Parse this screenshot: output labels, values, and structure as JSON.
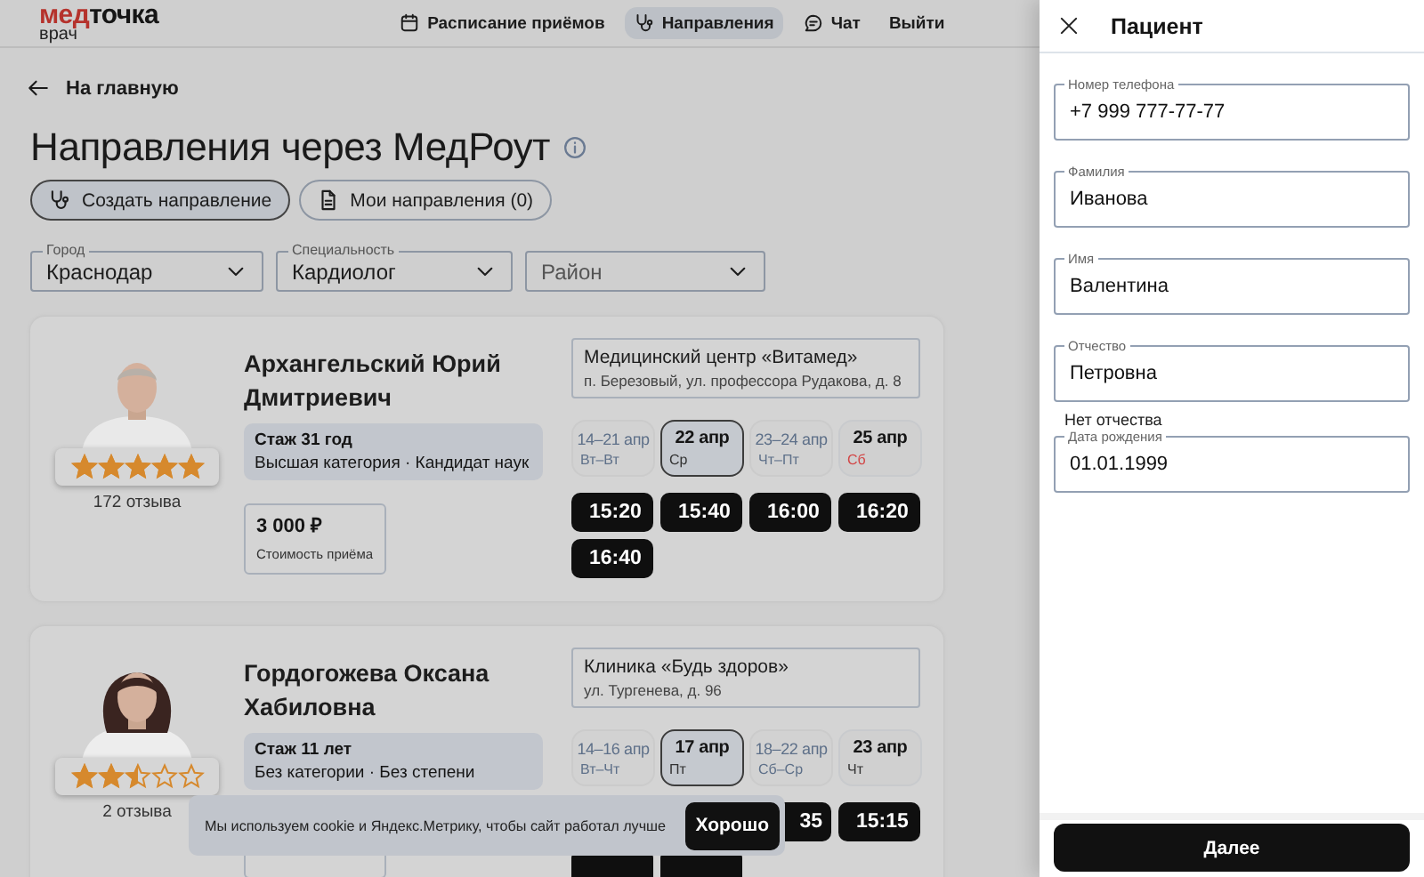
{
  "header": {
    "logo": {
      "brand_red": "мед",
      "brand_dark": "точка",
      "subtitle": "врач"
    },
    "nav": [
      {
        "label": "Расписание приёмов",
        "selected": false
      },
      {
        "label": "Направления",
        "selected": true
      },
      {
        "label": "Чат",
        "selected": false
      },
      {
        "label": "Выйти",
        "selected": false
      }
    ]
  },
  "back_link": "На главную",
  "title": "Направления через МедРоут",
  "actions": [
    {
      "label": "Создать направление",
      "selected": true
    },
    {
      "label": "Мои направления (0)",
      "selected": false
    }
  ],
  "filters": [
    {
      "label": "Город",
      "value": "Краснодар"
    },
    {
      "label": "Специальность",
      "value": "Кардиолог"
    },
    {
      "placeholder": "Район"
    }
  ],
  "doctors": [
    {
      "name": "Архангельский Юрий Дмитриевич",
      "stars": 5,
      "reviews": "172 отзыва",
      "experience": "Стаж 31 год",
      "qualification": "Высшая категория · Кандидат наук",
      "price": "3 000 ₽",
      "price_label": "Стоимость приёма",
      "clinic": "Медицинский центр «Витамед»",
      "address": "п. Березовый, ул. профессора Рудакова, д. 8",
      "dates": [
        {
          "date": "14–21 апр",
          "weekday": "Вт–Вт",
          "kind": "range",
          "selected": false,
          "weekend": false
        },
        {
          "date": "22 апр",
          "weekday": "Ср",
          "kind": "day",
          "selected": true,
          "weekend": false
        },
        {
          "date": "23–24 апр",
          "weekday": "Чт–Пт",
          "kind": "range",
          "selected": false,
          "weekend": false
        },
        {
          "date": "25 апр",
          "weekday": "Сб",
          "kind": "day",
          "selected": false,
          "weekend": true
        }
      ],
      "times": [
        {
          "time": "15:20"
        },
        {
          "time": "15:40"
        },
        {
          "time": "16:00"
        },
        {
          "time": "16:20"
        },
        {
          "time": "16:40"
        }
      ]
    },
    {
      "name": "Гордогожева Оксана Хабиловна",
      "stars": 2.5,
      "reviews": "2 отзыва",
      "experience": "Стаж 11 лет",
      "qualification": "Без категории · Без степени",
      "clinic": "Клиника «Будь здоров»",
      "address": "ул. Тургенева, д. 96",
      "dates": [
        {
          "date": "14–16 апр",
          "weekday": "Вт–Чт",
          "kind": "range",
          "selected": false,
          "weekend": false
        },
        {
          "date": "17 апр",
          "weekday": "Пт",
          "kind": "day",
          "selected": true,
          "weekend": false
        },
        {
          "date": "18–22 апр",
          "weekday": "Сб–Ср",
          "kind": "range",
          "selected": false,
          "weekend": false
        },
        {
          "date": "23 апр",
          "weekday": "Чт",
          "kind": "day",
          "selected": false,
          "weekend": false
        }
      ],
      "times": [
        {
          "time": "35",
          "kind": "partial"
        },
        {
          "time": "15:15",
          "kind": "full"
        },
        {
          "covered": true
        },
        {
          "covered": true
        }
      ]
    }
  ],
  "cookie_banner": {
    "text": "Мы используем cookie и Яндекс.Метрику, чтобы сайт работал лучше",
    "button": "Хорошо"
  },
  "patient_panel": {
    "title": "Пациент",
    "fields": [
      {
        "label": "Номер телефона",
        "value": "+7 999 777-77-77"
      },
      {
        "label": "Фамилия",
        "value": "Иванова"
      },
      {
        "label": "Имя",
        "value": "Валентина"
      },
      {
        "label": "Отчество",
        "value": "Петровна"
      },
      {
        "label": "Дата рождения",
        "value": "01.01.1999"
      }
    ],
    "no_patronymic": "Нет отчества",
    "next_button": "Далее"
  }
}
